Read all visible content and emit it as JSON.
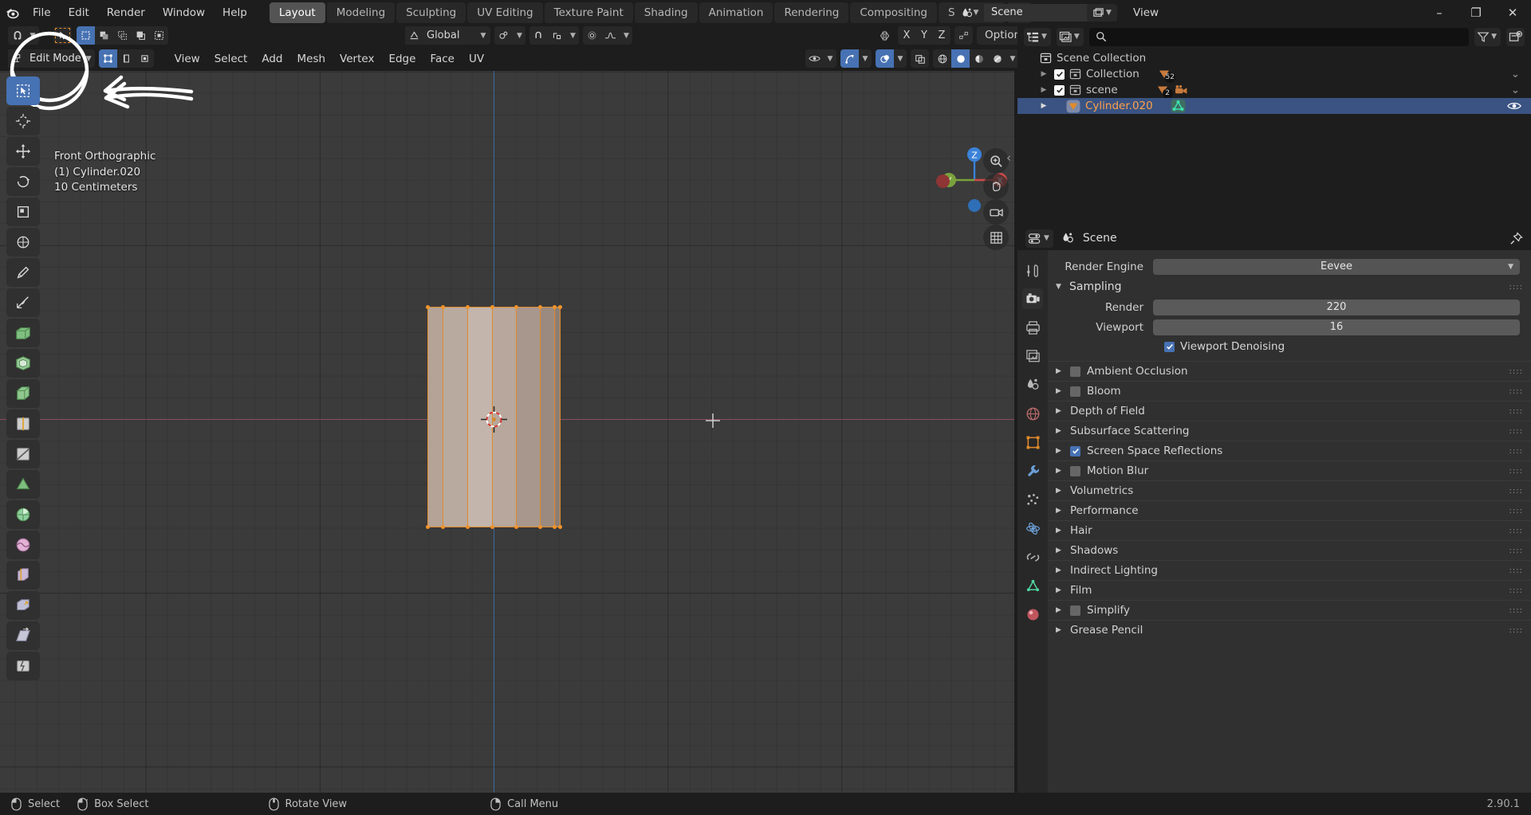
{
  "app": {
    "version": "2.90.1",
    "logo_icon": "blender-logo"
  },
  "topbar": {
    "menus": [
      "File",
      "Edit",
      "Render",
      "Window",
      "Help"
    ],
    "workspace_tabs": [
      {
        "label": "Layout",
        "active": true
      },
      {
        "label": "Modeling",
        "active": false
      },
      {
        "label": "Sculpting",
        "active": false
      },
      {
        "label": "UV Editing",
        "active": false
      },
      {
        "label": "Texture Paint",
        "active": false
      },
      {
        "label": "Shading",
        "active": false
      },
      {
        "label": "Animation",
        "active": false
      },
      {
        "label": "Rendering",
        "active": false
      },
      {
        "label": "Compositing",
        "active": false
      },
      {
        "label": "Scripting",
        "active": false
      }
    ],
    "add_workspace": "+",
    "scene_name": "Scene",
    "scene_unlink": "x",
    "view_layer_label": "View",
    "window_minimize": "–",
    "window_maximize": "❐",
    "window_close": "✕"
  },
  "viewport_header": {
    "editor_icon": "editor-type-icon",
    "mode": "Edit Mode",
    "select_mode_icons": [
      "vertex-select-icon",
      "edge-select-icon",
      "face-select-icon"
    ],
    "menus": [
      "View",
      "Select",
      "Add",
      "Mesh",
      "Vertex",
      "Edge",
      "Face",
      "UV"
    ],
    "transform_orientation_icon": "global-orientation-icon",
    "transform_orientation": "Global",
    "snap_icon": "magnet-icon",
    "pivot_icon": "pivot-point-icon",
    "proportional_icon": "proportional-edit-icon",
    "proportional_falloff_icon": "falloff-curve-icon",
    "mirror_icon": "mirror-icon",
    "mirror_axes": [
      "X",
      "Y",
      "Z"
    ],
    "mirror_topology_icon": "topology-mirror-icon",
    "options_label": "Options",
    "visibility_icon": "eye-icon",
    "gizmo_icon": "gizmo-icon",
    "overlays_icon": "overlays-icon",
    "xray_icon": "xray-toggle-icon",
    "shading_modes": [
      "wireframe-shading-icon",
      "solid-shading-icon",
      "material-shading-icon",
      "rendered-shading-icon"
    ],
    "shading_active": "solid-shading-icon"
  },
  "toolbar": {
    "tools": [
      {
        "name": "tweak-tool",
        "icon": "cursor-arrow-icon",
        "active": true
      },
      {
        "name": "cursor-tool",
        "icon": "3d-cursor-icon",
        "active": false
      },
      {
        "name": "move-tool",
        "icon": "move-arrows-icon",
        "active": false
      },
      {
        "name": "rotate-tool",
        "icon": "rotate-icon",
        "active": false
      },
      {
        "name": "scale-tool",
        "icon": "scale-icon",
        "active": false
      },
      {
        "name": "transform-tool",
        "icon": "transform-icon",
        "active": false
      },
      {
        "name": "annotate-tool",
        "icon": "pencil-icon",
        "active": false
      },
      {
        "name": "measure-tool",
        "icon": "ruler-icon",
        "active": false
      },
      {
        "name": "extrude-region-tool",
        "icon": "extrude-icon",
        "active": false
      },
      {
        "name": "inset-faces-tool",
        "icon": "inset-faces-icon",
        "active": false
      },
      {
        "name": "bevel-tool",
        "icon": "bevel-icon",
        "active": false
      },
      {
        "name": "loop-cut-tool",
        "icon": "loop-cut-icon",
        "active": false
      },
      {
        "name": "knife-tool",
        "icon": "knife-icon",
        "active": false
      },
      {
        "name": "poly-build-tool",
        "icon": "poly-build-icon",
        "active": false
      },
      {
        "name": "spin-tool",
        "icon": "spin-icon",
        "active": false
      },
      {
        "name": "smooth-tool",
        "icon": "smooth-icon",
        "active": false
      },
      {
        "name": "edge-slide-tool",
        "icon": "edge-slide-icon",
        "active": false
      },
      {
        "name": "shrink-fatten-tool",
        "icon": "shrink-fatten-icon",
        "active": false
      },
      {
        "name": "shear-tool",
        "icon": "shear-icon",
        "active": false
      },
      {
        "name": "rip-region-tool",
        "icon": "rip-region-icon",
        "active": false
      }
    ]
  },
  "viewport_overlay": {
    "view_name": "Front Orthographic",
    "object_name": "(1) Cylinder.020",
    "grid_scale": "10 Centimeters",
    "gizmo_axes": [
      "Z",
      "Y",
      "X"
    ],
    "nav_buttons": [
      "zoom-icon",
      "pan-hand-icon",
      "camera-view-icon",
      "toggle-ortho-icon"
    ],
    "sidebar_arrow": "‹"
  },
  "outliner": {
    "display_mode_icon": "outliner-display-mode-icon",
    "filter_scene_icon": "scene-data-icon",
    "search_icon": "search-icon",
    "search_placeholder": "",
    "filter_icon": "funnel-filter-icon",
    "new_collection_icon": "new-collection-icon",
    "rows": [
      {
        "name": "Scene Collection",
        "indent": 0,
        "icon": "collection-icon",
        "selected": false,
        "checkbox": false,
        "disclosure": "",
        "badges": []
      },
      {
        "name": "Collection",
        "indent": 1,
        "icon": "collection-icon",
        "selected": false,
        "checkbox": true,
        "disclosure": "▶",
        "badges": [
          {
            "icon": "mesh-data-icon",
            "count": "52"
          }
        ]
      },
      {
        "name": "scene",
        "indent": 1,
        "icon": "collection-icon",
        "selected": false,
        "checkbox": true,
        "disclosure": "▶",
        "badges": [
          {
            "icon": "mesh-data-icon",
            "count": "2"
          },
          {
            "icon": "camera-data-icon",
            "count": ""
          }
        ]
      },
      {
        "name": "Cylinder.020",
        "indent": 1,
        "icon": "mesh-object-icon",
        "selected": true,
        "checkbox": false,
        "disclosure": "▶",
        "badges": [
          {
            "icon": "edit-mesh-icon",
            "count": ""
          }
        ],
        "visibility_icon": "eye-open-icon"
      }
    ]
  },
  "properties": {
    "editor_icon": "properties-editor-icon",
    "breadcrumb": "Scene",
    "breadcrumb_icon": "scene-properties-icon",
    "pin_icon": "pin-icon",
    "tabs": [
      {
        "name": "tool-properties-tab",
        "icon": "tool-icon",
        "active": false
      },
      {
        "name": "render-properties-tab",
        "icon": "camera-back-icon",
        "active": true
      },
      {
        "name": "output-properties-tab",
        "icon": "printer-icon",
        "active": false
      },
      {
        "name": "view-layer-properties-tab",
        "icon": "images-icon",
        "active": false
      },
      {
        "name": "scene-properties-tab",
        "icon": "cone-droplet-icon",
        "active": false
      },
      {
        "name": "world-properties-tab",
        "icon": "globe-icon",
        "active": false
      },
      {
        "name": "object-properties-tab",
        "icon": "orange-square-icon",
        "active": false
      },
      {
        "name": "modifier-properties-tab",
        "icon": "wrench-icon",
        "active": false
      },
      {
        "name": "particle-properties-tab",
        "icon": "particles-icon",
        "active": false
      },
      {
        "name": "physics-properties-tab",
        "icon": "physics-orbit-icon",
        "active": false
      },
      {
        "name": "constraint-properties-tab",
        "icon": "constraint-icon",
        "active": false
      },
      {
        "name": "data-properties-tab",
        "icon": "green-triangle-data-icon",
        "active": false
      },
      {
        "name": "material-properties-tab",
        "icon": "material-sphere-icon",
        "active": false
      }
    ],
    "render_engine_label": "Render Engine",
    "render_engine_value": "Eevee",
    "sampling": {
      "title": "Sampling",
      "render_label": "Render",
      "render_value": "220",
      "viewport_label": "Viewport",
      "viewport_value": "16",
      "denoising_label": "Viewport Denoising",
      "denoising_checked": true
    },
    "panels": [
      {
        "label": "Ambient Occlusion",
        "checkbox": true,
        "checked": false
      },
      {
        "label": "Bloom",
        "checkbox": true,
        "checked": false
      },
      {
        "label": "Depth of Field",
        "checkbox": false,
        "checked": false
      },
      {
        "label": "Subsurface Scattering",
        "checkbox": false,
        "checked": false
      },
      {
        "label": "Screen Space Reflections",
        "checkbox": true,
        "checked": true
      },
      {
        "label": "Motion Blur",
        "checkbox": true,
        "checked": false
      },
      {
        "label": "Volumetrics",
        "checkbox": false,
        "checked": false
      },
      {
        "label": "Performance",
        "checkbox": false,
        "checked": false
      },
      {
        "label": "Hair",
        "checkbox": false,
        "checked": false
      },
      {
        "label": "Shadows",
        "checkbox": false,
        "checked": false
      },
      {
        "label": "Indirect Lighting",
        "checkbox": false,
        "checked": false
      },
      {
        "label": "Film",
        "checkbox": false,
        "checked": false
      },
      {
        "label": "Simplify",
        "checkbox": true,
        "checked": false
      },
      {
        "label": "Grease Pencil",
        "checkbox": false,
        "checked": false
      }
    ]
  },
  "status_bar": {
    "items": [
      {
        "icon": "mouse-left-icon",
        "label": "Select"
      },
      {
        "icon": "mouse-left-drag-icon",
        "label": "Box Select"
      },
      {
        "icon": "mouse-middle-icon",
        "label": "Rotate View"
      },
      {
        "icon": "mouse-right-icon",
        "label": "Call Menu"
      }
    ],
    "version": "2.90.1"
  },
  "annotation": {
    "circle_target": "Edit Mode dropdown highlighted with hand-drawn white circle",
    "arrow_target": "white hand-drawn arrow pointing to mode selector"
  },
  "colors": {
    "accent_blue": "#4772b3",
    "selected_orange": "#e08a2b",
    "vertex_orange": "#f0932a",
    "panel_dark": "#1d1d1d",
    "panel_mid": "#303030",
    "viewport_bg": "#3b3b3b",
    "outliner_select": "#3a5382",
    "outliner_name_active": "#ffa14a"
  }
}
